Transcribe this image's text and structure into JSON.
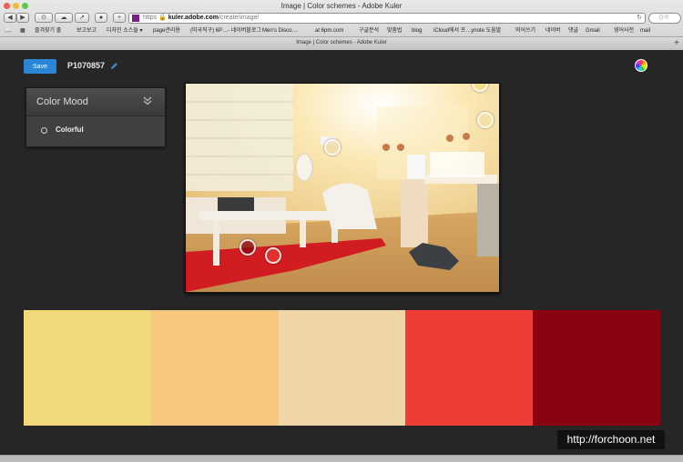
{
  "window": {
    "title": "Image | Color schemes - Adobe Kuler",
    "traffic_lights": [
      "#ec5f57",
      "#f1bc37",
      "#5cc84f"
    ]
  },
  "toolbar": {
    "back_icon": "back-arrow-icon",
    "forward_icon": "forward-arrow-icon",
    "url_scheme": "https",
    "url_host": "kuler.adobe.com",
    "url_path": "/create/image/",
    "search_placeholder": "검색"
  },
  "bookmarks": [
    "즐겨찾기 출",
    "보고보고",
    "디자인 소스들 ▾",
    "page관리용",
    "(미국직구) 6P…- 네이버블로그",
    "Men's Disco…",
    "at 6pm.com",
    "구글분석",
    "맞춤법",
    "blog",
    "iCloud에서 프…ynote 도움말",
    "띄어쓰기",
    "네이버",
    "댓글",
    "Gmail",
    "영어사전",
    "mail"
  ],
  "tab": {
    "label": "Image | Color schemes - Adobe Kuler"
  },
  "header": {
    "save_label": "Save",
    "image_name": "P1070857"
  },
  "color_mood": {
    "title": "Color Mood",
    "selected_option": "Colorful"
  },
  "swatches": [
    "#f1d97b",
    "#f5c77f",
    "#efd5a7",
    "#ee3d37",
    "#8a0312"
  ],
  "watermark": "http://forchoon.net"
}
